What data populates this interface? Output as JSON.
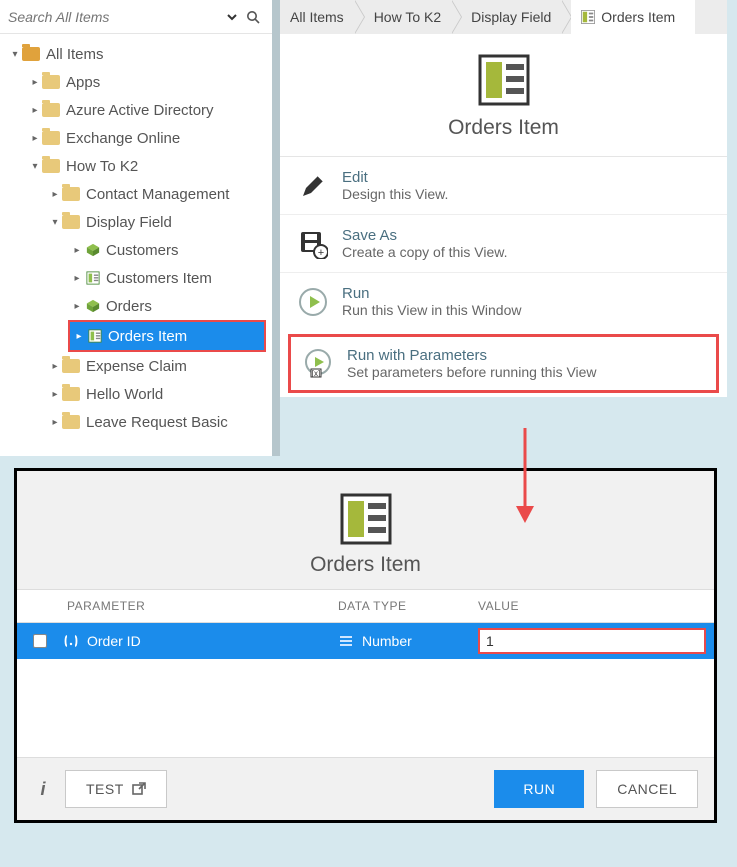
{
  "search": {
    "placeholder": "Search All Items"
  },
  "tree": {
    "root": "All Items",
    "apps": "Apps",
    "aad": "Azure Active Directory",
    "exo": "Exchange Online",
    "howto": "How To K2",
    "contact": "Contact Management",
    "display": "Display Field",
    "customers": "Customers",
    "customers_item": "Customers Item",
    "orders": "Orders",
    "orders_item": "Orders Item",
    "expense": "Expense Claim",
    "hello": "Hello World",
    "leave": "Leave Request Basic"
  },
  "breadcrumbs": [
    "All Items",
    "How To K2",
    "Display Field",
    "Orders Item"
  ],
  "header": {
    "title": "Orders Item"
  },
  "actions": {
    "edit": {
      "title": "Edit",
      "sub": "Design this View."
    },
    "saveas": {
      "title": "Save As",
      "sub": "Create a copy of this View."
    },
    "run": {
      "title": "Run",
      "sub": "Run this View in this Window"
    },
    "runp": {
      "title": "Run with Parameters",
      "sub": "Set parameters before running this View"
    }
  },
  "dialog": {
    "title": "Orders Item",
    "cols": {
      "param": "PARAMETER",
      "dt": "DATA TYPE",
      "val": "VALUE"
    },
    "row": {
      "param": "Order ID",
      "dt": "Number",
      "val": "1"
    },
    "test": "TEST",
    "run": "RUN",
    "cancel": "CANCEL"
  }
}
